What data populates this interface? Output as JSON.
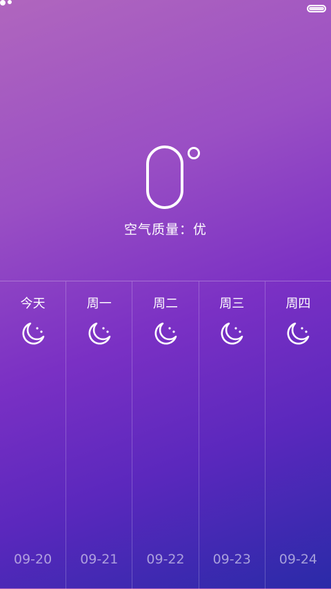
{
  "current": {
    "temperature": "0",
    "unit_symbol": "°",
    "air_quality": "空气质量：优"
  },
  "forecast": [
    {
      "day": "今天",
      "date": "09-20",
      "icon": "moon-stars-icon"
    },
    {
      "day": "周一",
      "date": "09-21",
      "icon": "moon-stars-icon"
    },
    {
      "day": "周二",
      "date": "09-22",
      "icon": "moon-stars-icon"
    },
    {
      "day": "周三",
      "date": "09-23",
      "icon": "moon-stars-icon"
    },
    {
      "day": "周四",
      "date": "09-24",
      "icon": "moon-stars-icon"
    }
  ],
  "colors": {
    "gradient_top": "#b066be",
    "gradient_bottom": "#2a2aa8",
    "text": "#ffffff"
  }
}
